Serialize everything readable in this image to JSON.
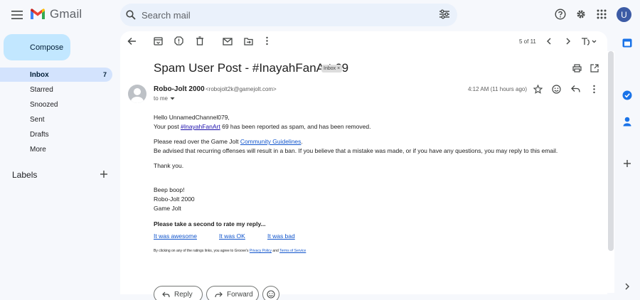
{
  "app": {
    "name": "Gmail",
    "avatar_letter": "U"
  },
  "search": {
    "placeholder": "Search mail"
  },
  "compose": {
    "label": "Compose"
  },
  "nav": {
    "items": [
      {
        "label": "Inbox",
        "count": "7"
      },
      {
        "label": "Starred"
      },
      {
        "label": "Snoozed"
      },
      {
        "label": "Sent"
      },
      {
        "label": "Drafts"
      },
      {
        "label": "More"
      }
    ],
    "labels_heading": "Labels"
  },
  "pager": {
    "text": "5 of 11"
  },
  "email": {
    "subject": "Spam User Post - #InayahFanArt 69",
    "chip": "Inbox",
    "sender_name": "Robo-Jolt 2000",
    "sender_email": "<robojolt2k@gamejolt.com>",
    "to": "to me",
    "timestamp": "4:12 AM (11 hours ago)",
    "greeting": "Hello UnnamedChannel079,",
    "line1_prefix": "Your post ",
    "line1_link": "#InayahFanArt",
    "line1_suffix": " 69 has been reported as spam, and has been removed.",
    "line2_prefix": "Please read over the Game Jolt ",
    "line2_link": "Community Guidelines",
    "line2_suffix": ".",
    "line3": "Be advised that recurring offenses will result in a ban. If you believe that a mistake was made, or if you have any questions, you may reply to this email.",
    "thanks": "Thank you.",
    "sig1": "Beep boop!",
    "sig2": "Robo-Jolt 2000",
    "sig3": "Game Jolt",
    "rate_heading": "Please take a second to rate my reply...",
    "rate_options": [
      "It was awesome",
      "It was OK",
      "It was bad"
    ],
    "footer_prefix": "By clicking on any of the ratings links, you agree to Groove's ",
    "footer_privacy": "Privacy Policy",
    "footer_and": " and ",
    "footer_terms": "Terms of Service",
    "reply_label": "Reply",
    "forward_label": "Forward"
  },
  "colors": {
    "background": "#f6f8fc",
    "compose": "#c2e7ff",
    "active_nav": "#d3e3fd",
    "link": "#1155cc"
  }
}
